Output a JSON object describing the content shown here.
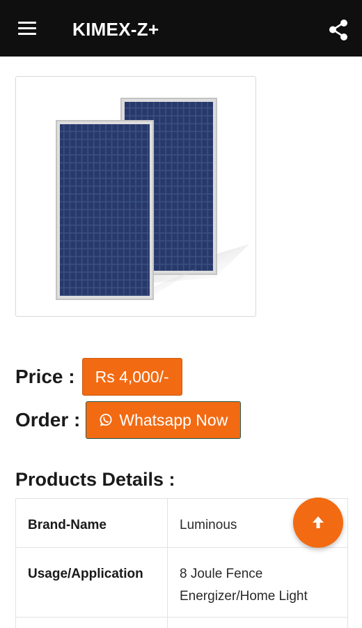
{
  "app_bar": {
    "title": "KIMEX-Z+",
    "menu_icon": "menu-icon",
    "share_icon": "share-icon",
    "background": "#0f0f0f"
  },
  "product": {
    "image": "solar-panels-image",
    "price_label": "Price :",
    "price_value": "Rs 4,000/-",
    "order_label": "Order :",
    "order_button": "Whatsapp Now",
    "order_icon": "whatsapp-icon"
  },
  "details": {
    "title": "Products Details :",
    "rows": [
      {
        "key": "Brand-Name",
        "value": "Luminous"
      },
      {
        "key": "Usage/Application",
        "value": "8 Joule Fence Energizer/Home Light"
      },
      {
        "key": "",
        "value": ""
      }
    ]
  },
  "fab": {
    "icon": "arrow-up-icon"
  },
  "colors": {
    "accent": "#f26b12",
    "panel_cell": "#2b3f6e"
  }
}
